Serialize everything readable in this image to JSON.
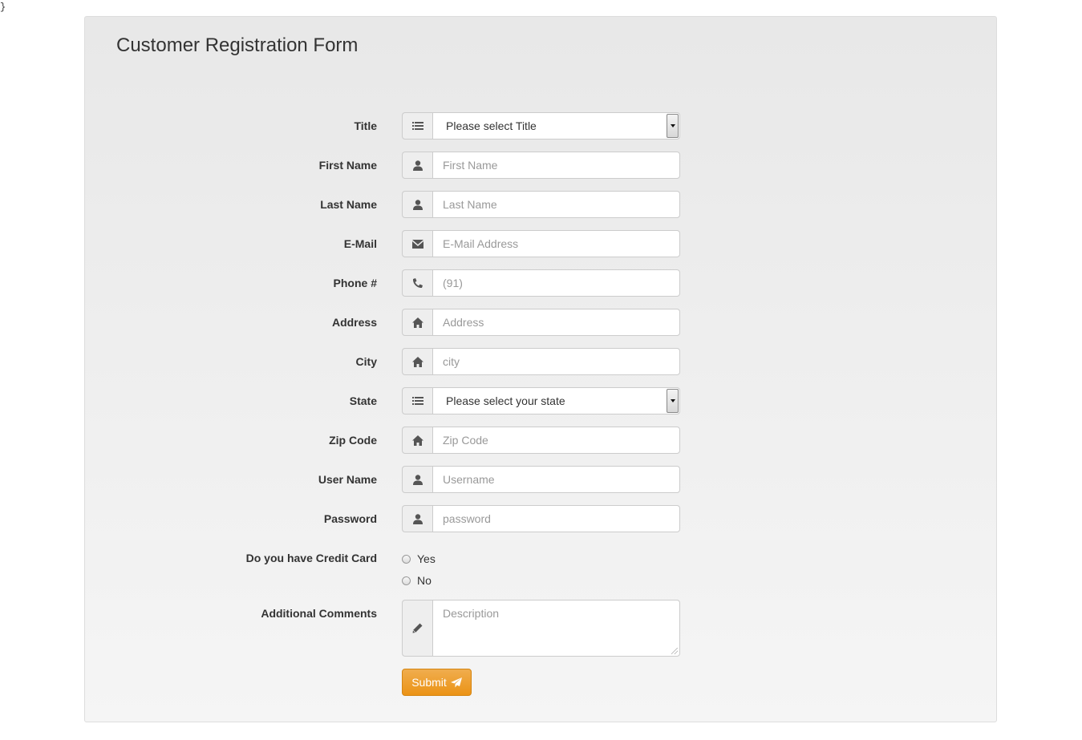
{
  "stray_text": "}",
  "form": {
    "title": "Customer Registration Form",
    "fields": {
      "title": {
        "label": "Title",
        "selected": "Please select Title",
        "icon": "list-icon"
      },
      "first_name": {
        "label": "First Name",
        "placeholder": "First Name",
        "icon": "user-icon"
      },
      "last_name": {
        "label": "Last Name",
        "placeholder": "Last Name",
        "icon": "user-icon"
      },
      "email": {
        "label": "E-Mail",
        "placeholder": "E-Mail Address",
        "icon": "envelope-icon"
      },
      "phone": {
        "label": "Phone #",
        "placeholder": "(91)",
        "icon": "phone-icon"
      },
      "address": {
        "label": "Address",
        "placeholder": "Address",
        "icon": "home-icon"
      },
      "city": {
        "label": "City",
        "placeholder": "city",
        "icon": "home-icon"
      },
      "state": {
        "label": "State",
        "selected": "Please select your state",
        "icon": "list-icon"
      },
      "zip": {
        "label": "Zip Code",
        "placeholder": "Zip Code",
        "icon": "home-icon"
      },
      "username": {
        "label": "User Name",
        "placeholder": "Username",
        "icon": "user-icon"
      },
      "password": {
        "label": "Password",
        "placeholder": "password",
        "icon": "user-icon"
      }
    },
    "credit_card": {
      "label": "Do you have Credit Card",
      "options": [
        "Yes",
        "No"
      ]
    },
    "comments": {
      "label": "Additional Comments",
      "placeholder": "Description",
      "icon": "pencil-icon"
    },
    "submit_label": "Submit",
    "colors": {
      "accent": "#f0ad4e",
      "panel_bg": "#efefef"
    }
  }
}
